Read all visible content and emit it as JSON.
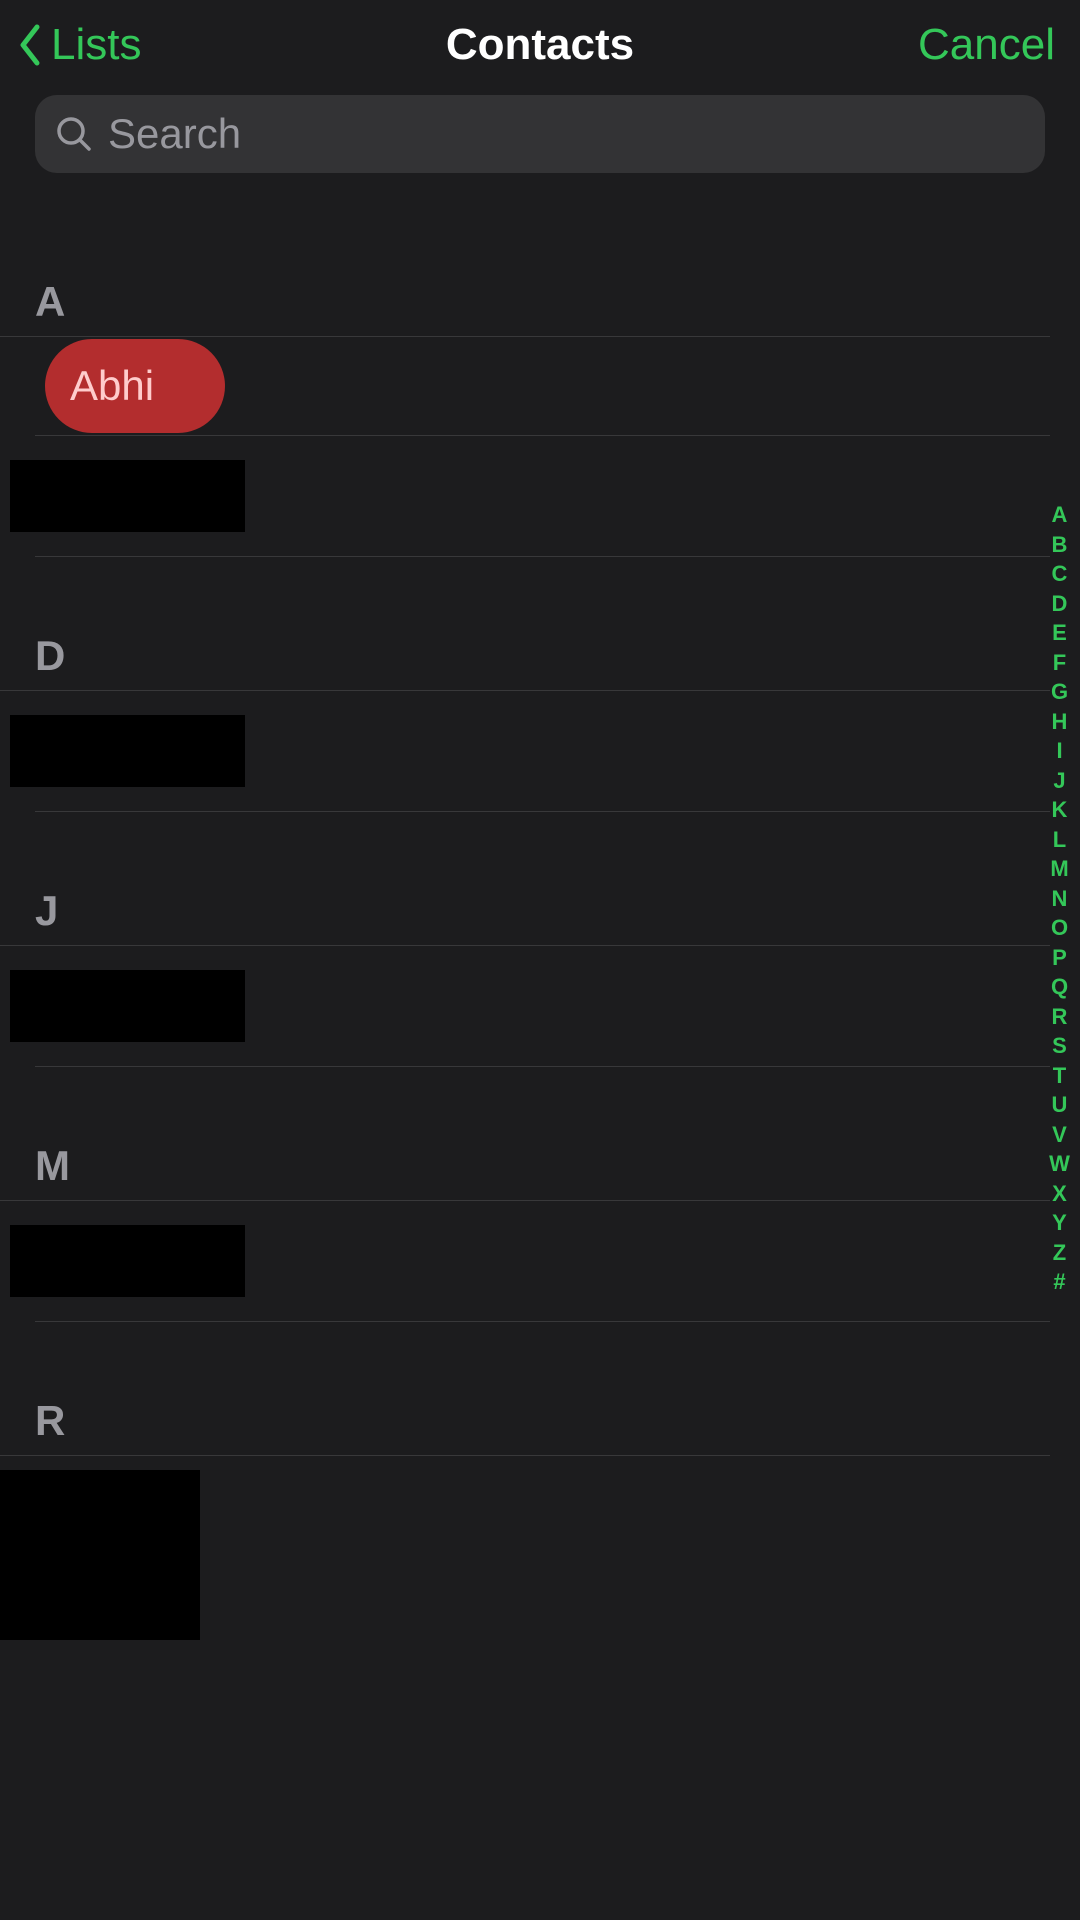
{
  "colors": {
    "accent": "#34c759",
    "background": "#1c1c1e",
    "highlight": "#b32d2e"
  },
  "nav": {
    "back_label": "Lists",
    "title": "Contacts",
    "cancel_label": "Cancel"
  },
  "search": {
    "placeholder": "Search",
    "value": ""
  },
  "sections": [
    {
      "letter": "A",
      "contacts": [
        {
          "name": "Abhi",
          "highlighted": true
        },
        {
          "name": "",
          "redacted": true
        }
      ]
    },
    {
      "letter": "D",
      "contacts": [
        {
          "name": "",
          "redacted": true
        }
      ]
    },
    {
      "letter": "J",
      "contacts": [
        {
          "name": "",
          "redacted": true
        }
      ]
    },
    {
      "letter": "M",
      "contacts": [
        {
          "name": "",
          "redacted": true
        }
      ]
    },
    {
      "letter": "R",
      "contacts": [
        {
          "name": "",
          "redacted": true
        },
        {
          "name": "",
          "redacted": true
        }
      ]
    }
  ],
  "alpha_index": [
    "A",
    "B",
    "C",
    "D",
    "E",
    "F",
    "G",
    "H",
    "I",
    "J",
    "K",
    "L",
    "M",
    "N",
    "O",
    "P",
    "Q",
    "R",
    "S",
    "T",
    "U",
    "V",
    "W",
    "X",
    "Y",
    "Z",
    "#"
  ]
}
